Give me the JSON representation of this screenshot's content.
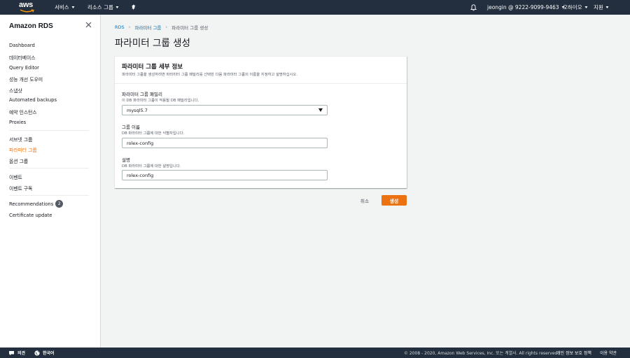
{
  "topnav": {
    "logo_text": "aws",
    "services_label": "서비스",
    "resource_groups_label": "리소스 그룹",
    "account_label": "jeongin @ 9222-9099-9463",
    "region_label": "오하이오",
    "support_label": "지원",
    "icons": {
      "pin": "pin-icon",
      "bell": "bell-icon",
      "caret": "caret-down-icon"
    }
  },
  "sidebar": {
    "title": "Amazon RDS",
    "group1": [
      "Dashboard",
      "데이터베이스",
      "Query Editor",
      "성능 개선 도우미",
      "스냅샷",
      "Automated backups",
      "예약 인스턴스",
      "Proxies"
    ],
    "group2": [
      "서브넷 그룹",
      "파라미터 그룹",
      "옵션 그룹"
    ],
    "group3": [
      "이벤트",
      "이벤트 구독"
    ],
    "group4": [
      "Recommendations",
      "Certificate update"
    ],
    "recommendations_badge": "2",
    "active_item": "파라미터 그룹"
  },
  "breadcrumb": {
    "items": [
      "RDS",
      "파라미터 그룹",
      "파라미터 그룹 생성"
    ]
  },
  "page": {
    "title": "파라미터 그룹 생성"
  },
  "panel": {
    "title": "파라미터 그룹 세부 정보",
    "description": "파라미터 그룹을 생성하려면 파라미터 그룹 패밀리를 선택한 다음 파라미터 그룹의 이름을 지정하고 설명하십시오."
  },
  "form": {
    "family": {
      "label": "파라미터 그룹 패밀리",
      "description": "이 DB 파라미터 그룹이 적용될 DB 패밀리입니다.",
      "value": "mysql5.7"
    },
    "group_name": {
      "label": "그룹 이름",
      "description": "DB 파라미터 그룹에 대한 식별자입니다.",
      "value": "rolex-config"
    },
    "description": {
      "label": "설명",
      "description": "DB 파라미터 그룹에 대한 설명입니다.",
      "value": "rolex-config"
    }
  },
  "actions": {
    "cancel": "취소",
    "create": "생성"
  },
  "footer": {
    "feedback": "의견",
    "language": "한국어",
    "copyright": "© 2008 - 2020, Amazon Web Services, Inc. 또는 계열사. All rights reserved.",
    "privacy": "개인 정보 보호 정책",
    "terms": "이용 약관"
  },
  "colors": {
    "nav_bg": "#232f3e",
    "accent": "#ec7211",
    "link": "#0073bb",
    "page_bg": "#f2f3f3"
  }
}
